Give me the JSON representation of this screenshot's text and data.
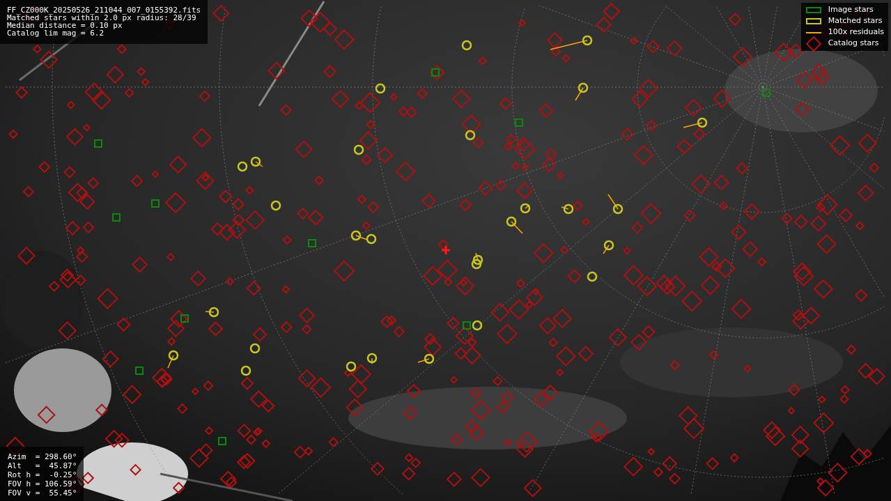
{
  "info_lines": [
    "FF_CZ000K_20250526_211044_007_0155392.fits",
    "Matched stars within 2.0 px radius: 28/39",
    "Median distance = 0.10 px",
    "Catalog lim mag = 6.2"
  ],
  "legend": [
    {
      "label": "Image stars"
    },
    {
      "kind": "matched",
      "label": "Matched stars"
    },
    {
      "kind": "residual",
      "label": "100x residuals"
    },
    {
      "kind": "catalog",
      "label": "Catalog stars"
    }
  ],
  "pointing_lines": [
    "Azim  = 298.60°",
    "Alt   =  45.87°",
    "Rot h =  -0.25°",
    "FOV h = 106.59°",
    "FOV v =  55.45°"
  ]
}
